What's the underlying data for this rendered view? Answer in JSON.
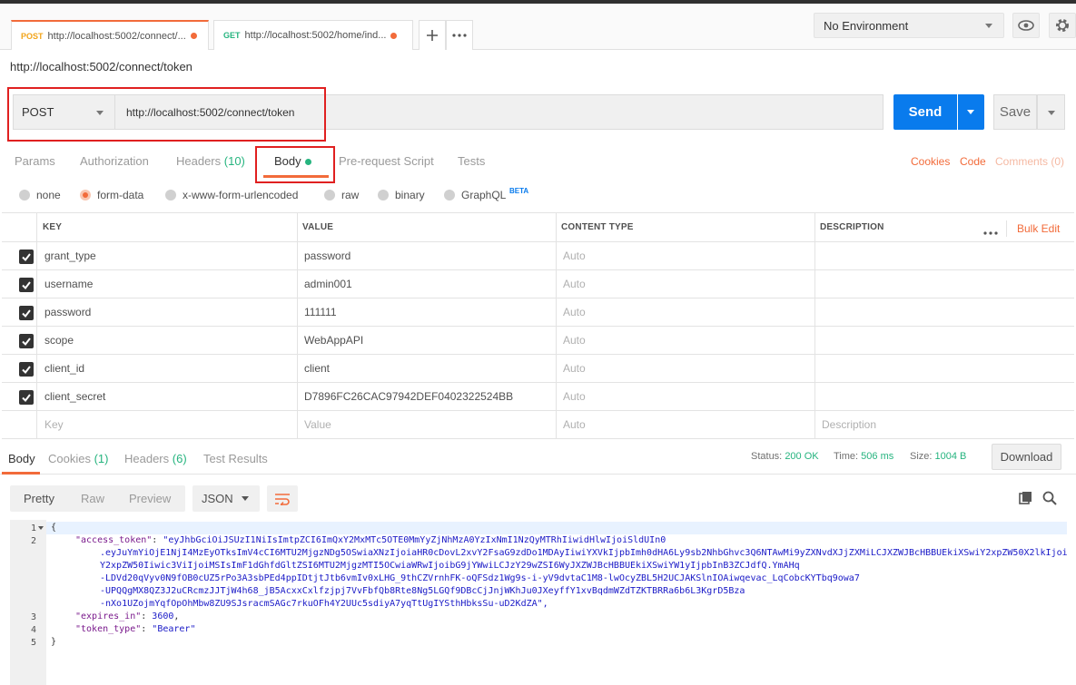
{
  "tabs": [
    {
      "method": "POST",
      "url": "http://localhost:5002/connect/...",
      "method_color": "#f2a41a"
    },
    {
      "method": "GET",
      "url": "http://localhost:5002/home/ind...",
      "method_color": "#26b47f"
    }
  ],
  "environment": {
    "selected": "No Environment"
  },
  "request": {
    "title": "http://localhost:5002/connect/token",
    "method": "POST",
    "url": "http://localhost:5002/connect/token",
    "send_label": "Send",
    "save_label": "Save"
  },
  "req_tabs": {
    "params": "Params",
    "authorization": "Authorization",
    "headers": "Headers",
    "headers_count": "(10)",
    "body": "Body",
    "prerequest": "Pre-request Script",
    "tests": "Tests",
    "cookies": "Cookies",
    "code": "Code",
    "comments": "Comments (0)"
  },
  "body_types": {
    "none": "none",
    "form_data": "form-data",
    "urlencoded": "x-www-form-urlencoded",
    "raw": "raw",
    "binary": "binary",
    "graphql": "GraphQL",
    "beta": "BETA",
    "selected": "form-data"
  },
  "table": {
    "headers": {
      "key": "KEY",
      "value": "VALUE",
      "content_type": "CONTENT TYPE",
      "description": "DESCRIPTION",
      "bulk_edit": "Bulk Edit"
    },
    "rows": [
      {
        "key": "grant_type",
        "value": "password",
        "content_type": "Auto",
        "checked": true
      },
      {
        "key": "username",
        "value": "admin001",
        "content_type": "Auto",
        "checked": true
      },
      {
        "key": "password",
        "value": "111111",
        "content_type": "Auto",
        "checked": true
      },
      {
        "key": "scope",
        "value": "WebAppAPI",
        "content_type": "Auto",
        "checked": true
      },
      {
        "key": "client_id",
        "value": "client",
        "content_type": "Auto",
        "checked": true
      },
      {
        "key": "client_secret",
        "value": "D7896FC26CAC97942DEF0402322524BB",
        "content_type": "Auto",
        "checked": true
      }
    ],
    "placeholder": {
      "key": "Key",
      "value": "Value",
      "content_type": "Auto",
      "description": "Description"
    }
  },
  "response": {
    "tabs": {
      "body": "Body",
      "cookies": "Cookies",
      "cookies_count": "(1)",
      "headers": "Headers",
      "headers_count": "(6)",
      "tests": "Test Results"
    },
    "status_label": "Status:",
    "status": "200 OK",
    "time_label": "Time:",
    "time": "506 ms",
    "size_label": "Size:",
    "size": "1004 B",
    "download": "Download",
    "views": {
      "pretty": "Pretty",
      "raw": "Raw",
      "preview": "Preview"
    },
    "format": "JSON",
    "code": {
      "line1": "{",
      "access_token_key": "\"access_token\"",
      "access_token_l1": "\"eyJhbGciOiJSUzI1NiIsImtpZCI6ImQxY2MxMTc5OTE0MmYyZjNhMzA0YzIxNmI1NzQyMTRhIiwidHlwIjoiSldUIn0",
      "access_token_l2": ".eyJuYmYiOjE1NjI4MzEyOTksImV4cCI6MTU2MjgzNDg5OSwiaXNzIjoiaHR0cDovL2xvY2FsaG9zdDo1MDAyIiwiYXVkIjpbImh0dHA6Ly9sb2NhbGhvc3Q6NTAwMi9yZXNvdXJjZXMiLCJXZWJBcHBBUEkiXSwiY2xpZW50X2lkIjoiY2xpZW50Iiwic3ViIjoiMSIsImF1dGhfdGltZSI6MTU2MjgzMTI5OCwiaWRwIjoibG9jYWwiLCJzY29wZSI6WyJXZWJBcHBBUEkiXSwiYW1yIjpbInB3ZCJdfQ.YmAHq",
      "access_token_l3": "-LDVd20qVyv0N9fOB0cUZ5rPo3A3sbPEd4ppIDtjtJtb6vmIv0xLHG_9thCZVrnhFK-oQFSdz1Wg9s-i-yV9dvtaC1M8-lwOcyZBL5H2UCJAKSlnIOAiwqevac_LqCobcKYTbq9owa7",
      "access_token_l4": "-UPQQgMX8QZ3J2uCRcmzJJTjW4h68_jB5AcxxCxlfzjpj7VvFbfQb8Rte8Ng5LGQf9DBcCjJnjWKhJu0JXeyffY1xvBqdmWZdTZKTBRRa6b6L3KgrD5Bza",
      "access_token_l5": "-nXo1UZojmYqfOpOhMbw8ZU9SJsracmSAGc7rkuOFh4Y2UUc5sdiyA7yqTtUgIYSthHbksSu-uD2KdZA\",",
      "expires_key": "\"expires_in\"",
      "expires_val": "3600",
      "token_type_key": "\"token_type\"",
      "token_type_val": "\"Bearer\"",
      "last": "}"
    },
    "line_numbers": [
      "1",
      "2",
      "3",
      "4",
      "5"
    ]
  }
}
